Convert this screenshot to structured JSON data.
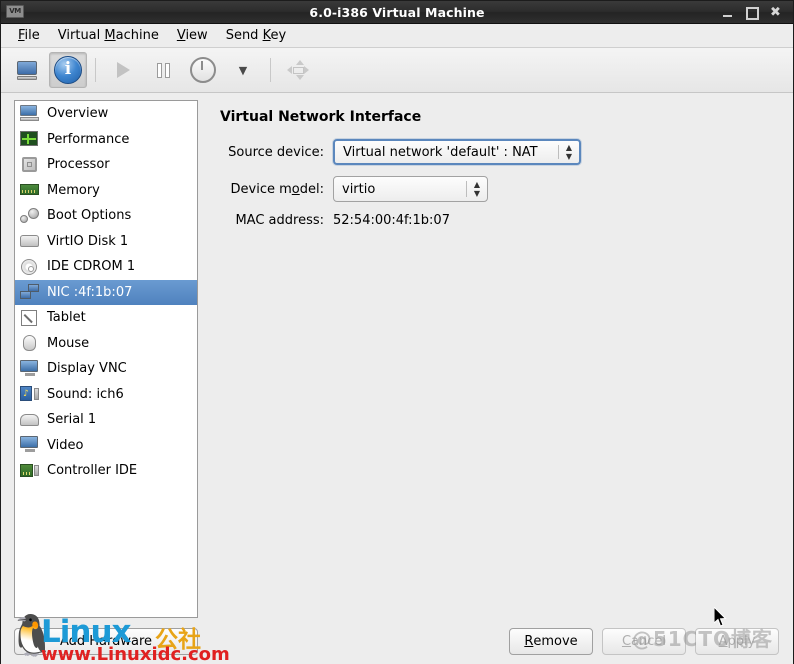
{
  "window": {
    "title": "6.0-i386 Virtual Machine",
    "icon": "vm-icon",
    "controls": {
      "minimize": "minimize-icon",
      "maximize": "maximize-icon",
      "close": "close-icon"
    }
  },
  "menubar": {
    "items": [
      {
        "label": "File",
        "mnemonic": "F"
      },
      {
        "label": "Virtual Machine",
        "mnemonic": "M"
      },
      {
        "label": "View",
        "mnemonic": "V"
      },
      {
        "label": "Send Key",
        "mnemonic": "K"
      }
    ]
  },
  "toolbar": {
    "buttons": [
      {
        "name": "show-console-button",
        "icon": "monitor-icon",
        "state": "normal"
      },
      {
        "name": "show-details-button",
        "icon": "info-icon",
        "state": "active"
      },
      {
        "name": "run-button",
        "icon": "play-icon",
        "state": "disabled"
      },
      {
        "name": "pause-button",
        "icon": "pause-icon",
        "state": "normal"
      },
      {
        "name": "shutdown-button",
        "icon": "power-icon",
        "state": "normal"
      },
      {
        "name": "shutdown-menu-button",
        "icon": "chevron-down-icon",
        "state": "normal"
      },
      {
        "name": "fullscreen-button",
        "icon": "fullscreen-icon",
        "state": "disabled"
      }
    ]
  },
  "sidebar": {
    "items": [
      {
        "label": "Overview",
        "icon": "computer-icon",
        "selected": false
      },
      {
        "label": "Performance",
        "icon": "chart-icon",
        "selected": false
      },
      {
        "label": "Processor",
        "icon": "cpu-icon",
        "selected": false
      },
      {
        "label": "Memory",
        "icon": "memory-icon",
        "selected": false
      },
      {
        "label": "Boot Options",
        "icon": "gears-icon",
        "selected": false
      },
      {
        "label": "VirtIO Disk 1",
        "icon": "harddisk-icon",
        "selected": false
      },
      {
        "label": "IDE CDROM 1",
        "icon": "cdrom-icon",
        "selected": false
      },
      {
        "label": "NIC :4f:1b:07",
        "icon": "network-icon",
        "selected": true
      },
      {
        "label": "Tablet",
        "icon": "tablet-icon",
        "selected": false
      },
      {
        "label": "Mouse",
        "icon": "mouse-icon",
        "selected": false
      },
      {
        "label": "Display VNC",
        "icon": "display-icon",
        "selected": false
      },
      {
        "label": "Sound: ich6",
        "icon": "sound-icon",
        "selected": false
      },
      {
        "label": "Serial 1",
        "icon": "serial-icon",
        "selected": false
      },
      {
        "label": "Video",
        "icon": "video-icon",
        "selected": false
      },
      {
        "label": "Controller IDE",
        "icon": "controller-icon",
        "selected": false
      }
    ],
    "add_hardware_label": "Add Hardware"
  },
  "main": {
    "title": "Virtual Network Interface",
    "fields": [
      {
        "label": "Source device:",
        "mnemonic": "",
        "type": "combo",
        "value": "Virtual network 'default' : NAT",
        "focused": true
      },
      {
        "label": "Device model:",
        "mnemonic": "o",
        "type": "combo",
        "value": "virtio",
        "focused": false
      },
      {
        "label": "MAC address:",
        "mnemonic": "",
        "type": "static",
        "value": "52:54:00:4f:1b:07",
        "focused": false
      }
    ]
  },
  "footer": {
    "buttons": [
      {
        "label": "Remove",
        "mnemonic": "R",
        "disabled": false
      },
      {
        "label": "Cancel",
        "mnemonic": "C",
        "disabled": true
      },
      {
        "label": "Apply",
        "mnemonic": "A",
        "disabled": true
      }
    ]
  },
  "watermarks": {
    "linux_word": "Linux",
    "linux_cn": "公社",
    "linux_url": "www.Linuxidc.com",
    "cto": "@51CTO博客"
  },
  "colors": {
    "selection": "#4f82be",
    "titlebar": "#2c2c2c",
    "background": "#ededed",
    "accent_blue": "#3f86d0"
  }
}
